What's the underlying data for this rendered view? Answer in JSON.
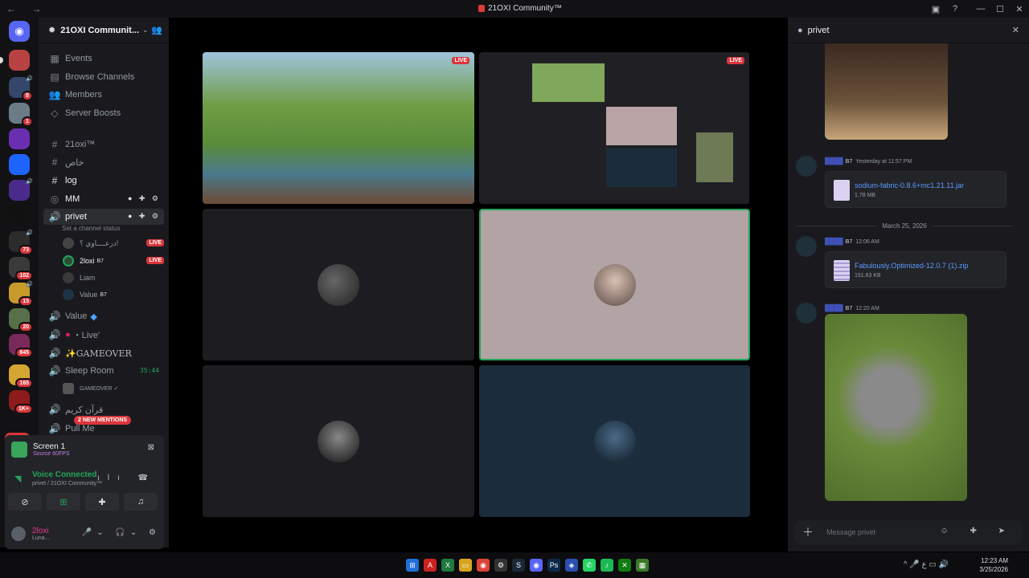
{
  "window": {
    "title": "21OXI Community™",
    "nav_glyphs": "← →"
  },
  "server": {
    "name": "21OXI Communit..."
  },
  "guild_badges": [
    "8",
    "1",
    "73",
    "102",
    "15",
    "20",
    "845",
    "165",
    "1K+"
  ],
  "new_pill": "NEW",
  "channels": {
    "events": "Events",
    "browse": "Browse Channels",
    "members": "Members",
    "boosts": "Server Boosts",
    "text1": "21oxi™",
    "text2": "خاص",
    "text3": "log",
    "voice_mm": "MM",
    "voice_privet": "privet",
    "privet_status": "Set a channel status",
    "voice_users": [
      {
        "name": "درعــــاوي ؟!",
        "tag": "",
        "live": "LIVE"
      },
      {
        "name": "2loxi",
        "tag": "B7",
        "live": "LIVE"
      },
      {
        "name": "Liam",
        "tag": "",
        "live": ""
      },
      {
        "name": "Value",
        "tag": "B7",
        "live": ""
      }
    ],
    "voice_value": "Value",
    "voice_live": "・Live'",
    "voice_gameover": "✨GAMEOVER",
    "voice_sleep": "Sleep Room",
    "sleep_timer": "35:44",
    "sleep_user": "GAMEOVER ✓",
    "voice_quran": "قرآن كريم",
    "voice_pull": "Pull Me",
    "mentions": "2 NEW MENTIONS"
  },
  "stream_panel": {
    "title": "Screen 1",
    "sub": "Source 60FPS",
    "voice_connected": "Voice Connected",
    "voice_sub": "privet / 21OXI Community™"
  },
  "user": {
    "name": "2loxi",
    "status": "Luna..."
  },
  "stage": {
    "live_label": "LIVE"
  },
  "thread": {
    "name": "privet",
    "msg1_tag": "B7",
    "msg1_time": "Yesterday at 11:57 PM",
    "file1_name": "sodium-fabric-0.8.6+mc1.21.11.jar",
    "file1_size": "1.78 MB",
    "date_sep": "March 25, 2026",
    "msg2_tag": "B7",
    "msg2_time": "12:06 AM",
    "file2_name": "Fabulously.Optimized-12.0.7 (1).zip",
    "file2_size": "151.63 KB",
    "msg3_tag": "B7",
    "msg3_time": "12:20 AM",
    "composer_placeholder": "Message privet"
  },
  "clock": {
    "time": "12:23 AM",
    "date": "3/25/2026"
  },
  "tray_lang": "ع"
}
